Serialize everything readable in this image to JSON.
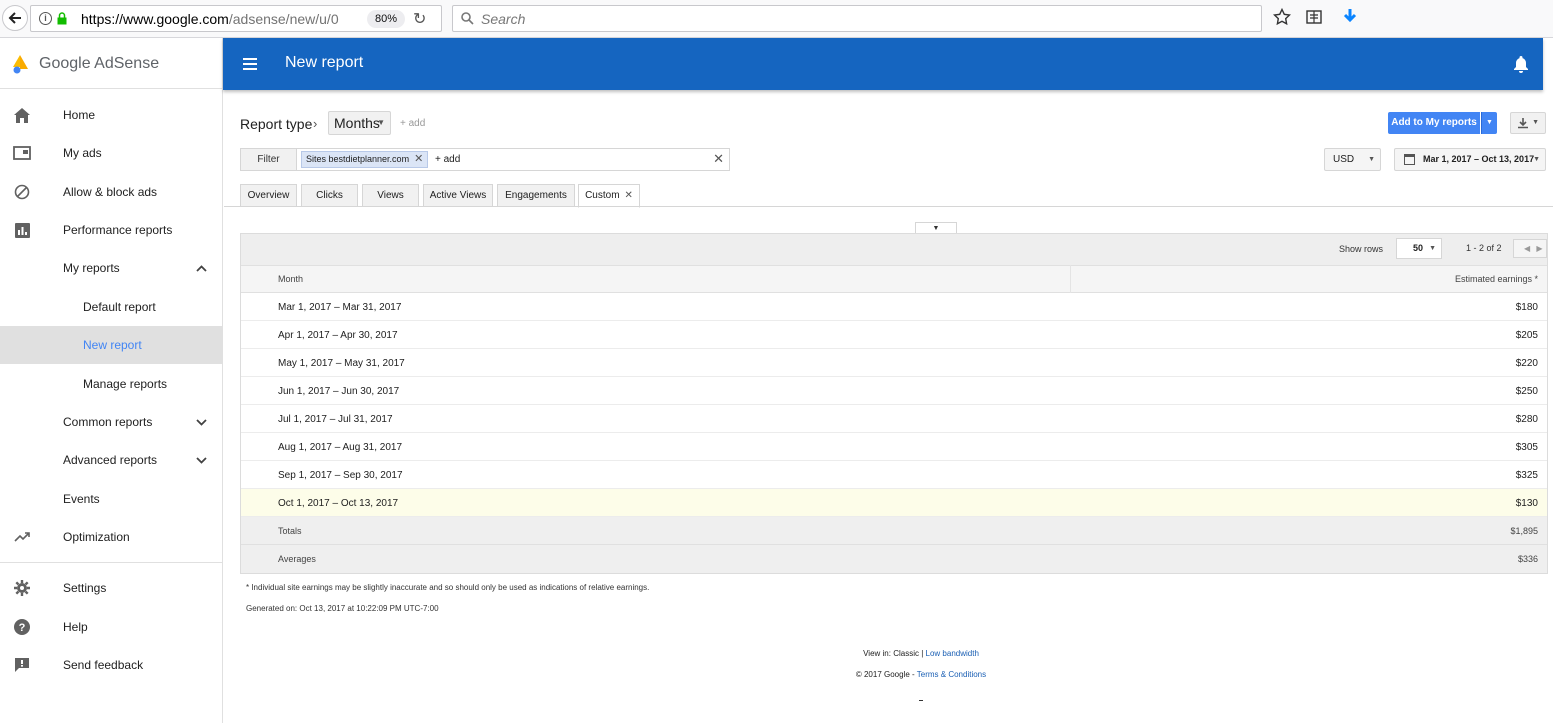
{
  "browser": {
    "url_host": "https://www.google.com",
    "url_path": "/adsense/new/u/0",
    "zoom": "80%",
    "search_placeholder": "Search"
  },
  "sidebar": {
    "brand": "Google AdSense",
    "items": [
      {
        "label": "Home",
        "icon": "home-icon"
      },
      {
        "label": "My ads",
        "icon": "ad-unit-icon"
      },
      {
        "label": "Allow & block ads",
        "icon": "block-icon"
      },
      {
        "label": "Performance reports",
        "icon": "bar-chart-icon"
      },
      {
        "label": "My reports"
      },
      {
        "label": "Default report"
      },
      {
        "label": "New report"
      },
      {
        "label": "Manage reports"
      },
      {
        "label": "Common reports"
      },
      {
        "label": "Advanced reports"
      },
      {
        "label": "Events"
      },
      {
        "label": "Optimization",
        "icon": "trending-up-icon"
      },
      {
        "label": "Settings",
        "icon": "gear-icon"
      },
      {
        "label": "Help",
        "icon": "help-icon"
      },
      {
        "label": "Send feedback",
        "icon": "feedback-icon"
      }
    ]
  },
  "appbar": {
    "title": "New report"
  },
  "report": {
    "report_type_label": "Report type",
    "dimension": "Months",
    "add_label": "+ add",
    "add_to_reports": "Add to My reports",
    "filter_label": "Filter",
    "filter_chip": "Sites bestdietplanner.com",
    "filter_add": "+ add",
    "currency": "USD",
    "date_range": "Mar 1, 2017 – Oct 13, 2017",
    "tabs": [
      "Overview",
      "Clicks",
      "Views",
      "Active Views",
      "Engagements",
      "Custom"
    ]
  },
  "table": {
    "show_rows_label": "Show rows",
    "rows_value": "50",
    "pager": "1 - 2 of 2",
    "headers": [
      "Month",
      "Estimated earnings *"
    ],
    "rows": [
      [
        "Mar 1, 2017 – Mar 31, 2017",
        "$180"
      ],
      [
        "Apr 1, 2017 – Apr 30, 2017",
        "$205"
      ],
      [
        "May 1, 2017 – May 31, 2017",
        "$220"
      ],
      [
        "Jun 1, 2017 – Jun 30, 2017",
        "$250"
      ],
      [
        "Jul 1, 2017 – Jul 31, 2017",
        "$280"
      ],
      [
        "Aug 1, 2017 – Aug 31, 2017",
        "$305"
      ],
      [
        "Sep 1, 2017 – Sep 30, 2017",
        "$325"
      ],
      [
        "Oct 1, 2017 – Oct 13, 2017",
        "$130"
      ]
    ],
    "totals_label": "Totals",
    "totals_value": "$1,895",
    "averages_label": "Averages",
    "averages_value": "$336"
  },
  "footer": {
    "footnote": "* Individual site earnings may be slightly inaccurate and so should only be used as indications of relative earnings.",
    "generated": "Generated on: Oct 13, 2017 at 10:22:09 PM UTC-7:00",
    "view_in_label": "View in:",
    "classic": "Classic",
    "low_bandwidth": "Low bandwidth",
    "copyright": "© 2017 Google",
    "terms": "Terms & Conditions"
  },
  "colors": {
    "appbar": "#1565c0",
    "primary_button": "#4285f4",
    "active_nav_text": "#4285f4",
    "highlight_row": "#fdfde9"
  }
}
